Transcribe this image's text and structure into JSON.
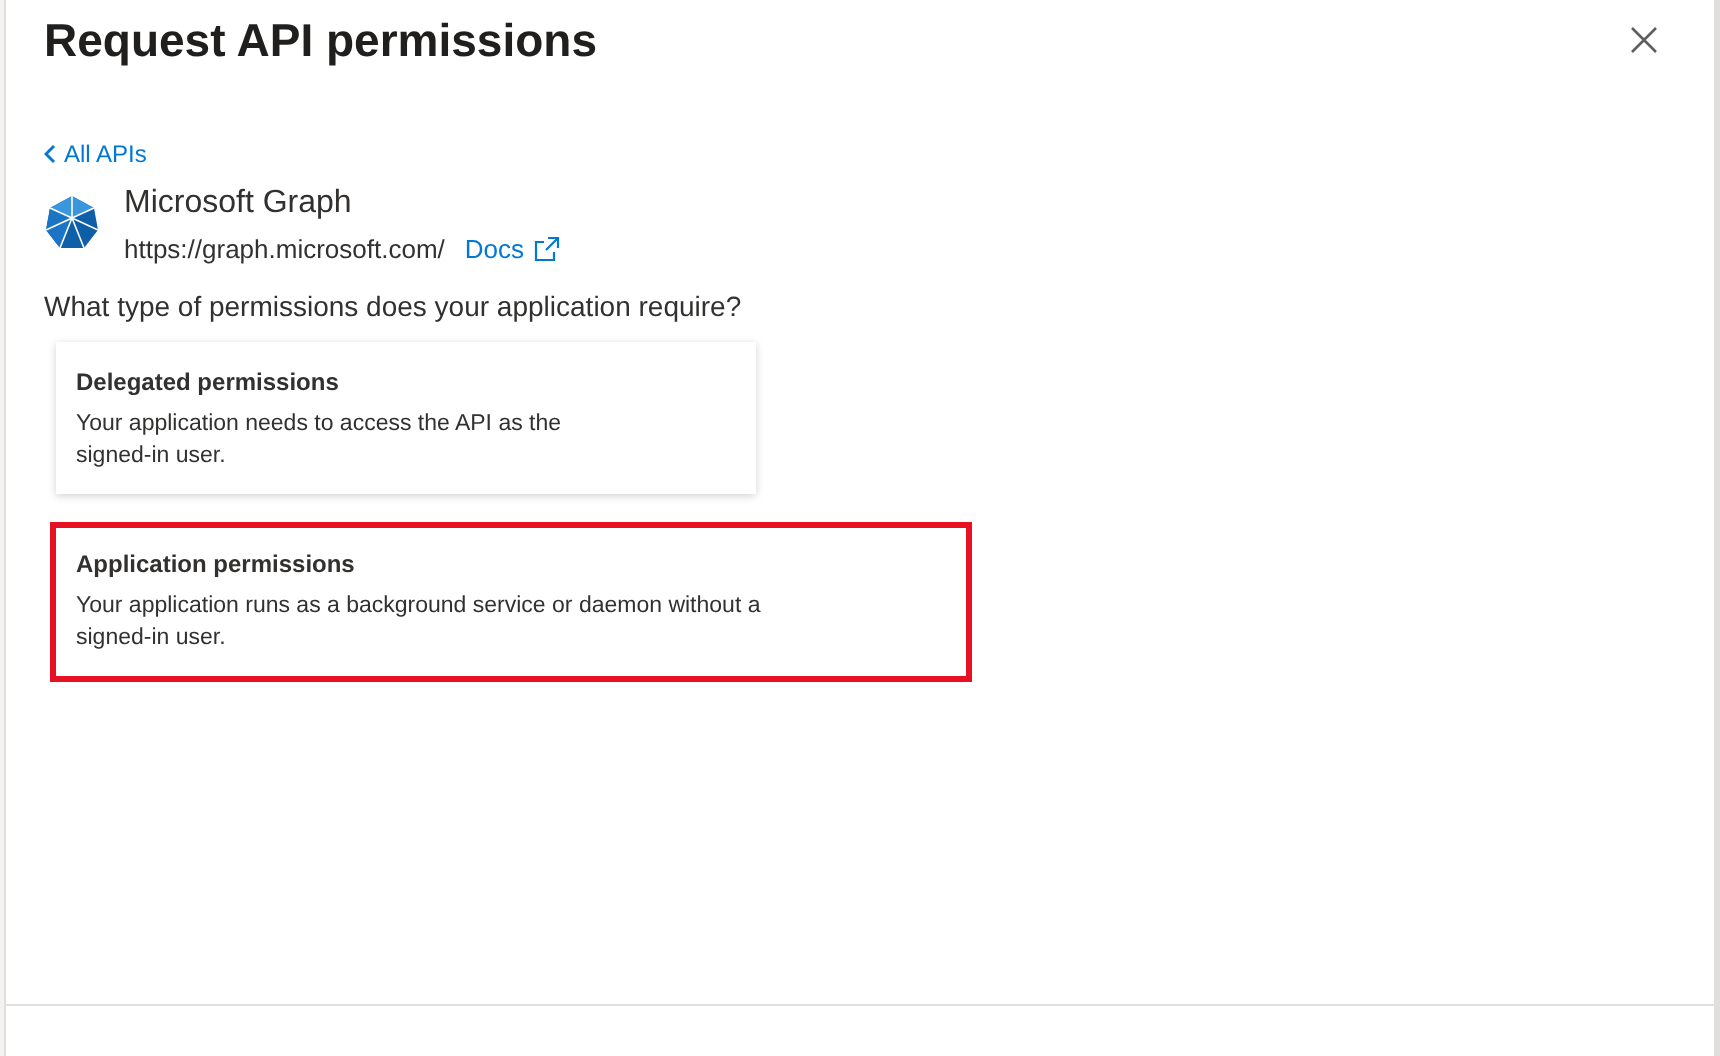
{
  "panel": {
    "title": "Request API permissions",
    "back_link": "All APIs"
  },
  "api": {
    "name": "Microsoft Graph",
    "url": "https://graph.microsoft.com/",
    "docs_link": "Docs"
  },
  "question": "What type of permissions does your application require?",
  "options": [
    {
      "title": "Delegated permissions",
      "description": "Your application needs to access the API as the signed-in user.",
      "highlighted": false
    },
    {
      "title": "Application permissions",
      "description": "Your application runs as a background service or daemon without a signed-in user.",
      "highlighted": true
    }
  ]
}
